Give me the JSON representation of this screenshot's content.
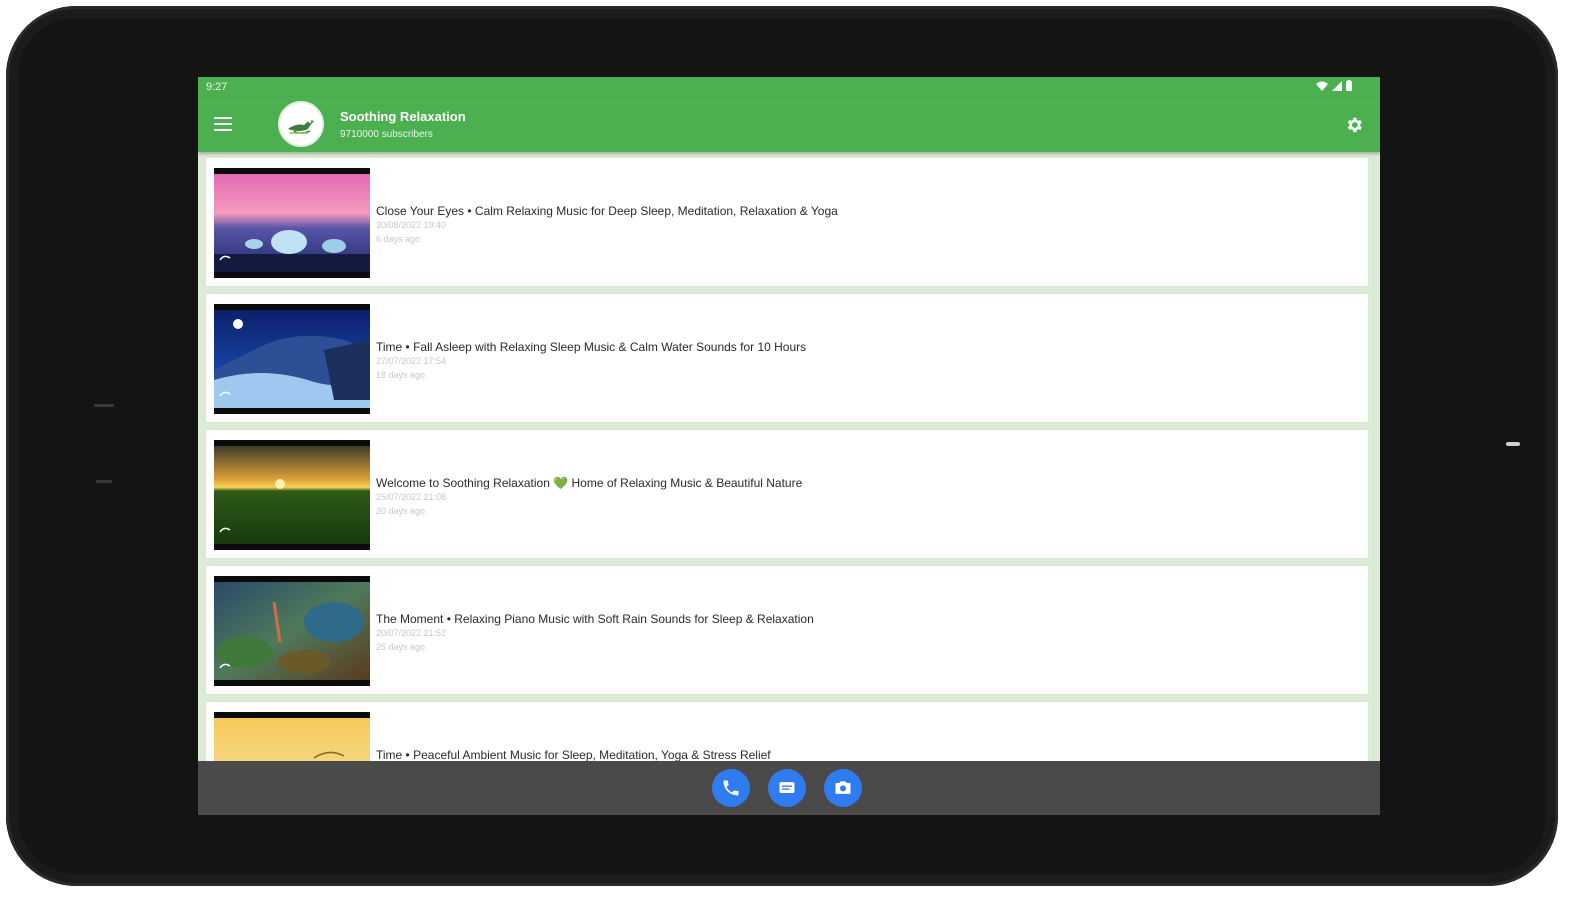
{
  "status_bar": {
    "time": "9:27"
  },
  "app_bar": {
    "channel_name": "Soothing Relaxation",
    "subscribers": "9710000 subscribers",
    "menu_icon": "hamburger-menu-icon",
    "settings_icon": "gear-icon"
  },
  "videos": [
    {
      "title": "Close Your Eyes • Calm Relaxing Music for Deep Sleep, Meditation, Relaxation & Yoga",
      "date": "30/08/2022 19:40",
      "ago": "6 days ago"
    },
    {
      "title": "Time • Fall Asleep with Relaxing Sleep Music & Calm Water Sounds for 10 Hours",
      "date": "27/07/2022 17:54",
      "ago": "18 days ago"
    },
    {
      "title": "Welcome to Soothing Relaxation 💚 Home of Relaxing Music & Beautiful Nature",
      "date": "25/07/2022 21:08",
      "ago": "20 days ago"
    },
    {
      "title": "The Moment • Relaxing Piano Music with Soft Rain Sounds for Sleep & Relaxation",
      "date": "20/07/2022 21:52",
      "ago": "25 days ago"
    },
    {
      "title": "Time • Peaceful Ambient Music for Sleep, Meditation, Yoga & Stress Relief",
      "date": "",
      "ago": ""
    }
  ],
  "dock": {
    "phone_icon": "phone-icon",
    "messages_icon": "message-icon",
    "camera_icon": "camera-icon"
  },
  "colors": {
    "accent": "#4caf50",
    "nav_bar": "#4a4a4a",
    "dock_button": "#2f7cf0",
    "list_background": "#dcebd6"
  }
}
